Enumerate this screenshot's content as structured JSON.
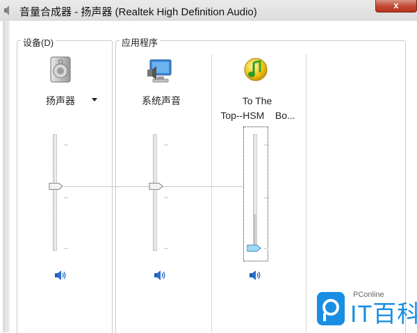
{
  "window": {
    "title": "音量合成器 - 扬声器 (Realtek High Definition Audio)",
    "close_symbol": "x",
    "icon": "speaker-icon"
  },
  "groups": {
    "device_label": "设备(D)",
    "apps_label": "应用程序"
  },
  "channels": [
    {
      "id": "speaker",
      "label": "扬声器",
      "icon": "speaker-device-icon",
      "has_dropdown": true,
      "volume_level": 0.52,
      "mute_icon": "volume-icon"
    },
    {
      "id": "system-sounds",
      "label": "系统声音",
      "icon": "system-sounds-icon",
      "volume_level": 0.52,
      "mute_icon": "volume-icon"
    },
    {
      "id": "qq-music",
      "label_line1": "To The",
      "label_line2": "Top--HSM    Bo...",
      "icon": "music-note-icon",
      "volume_level": 0.07,
      "mute_icon": "volume-icon",
      "focused": true
    }
  ],
  "watermark": {
    "small": "PConline",
    "big": "IT百科"
  }
}
